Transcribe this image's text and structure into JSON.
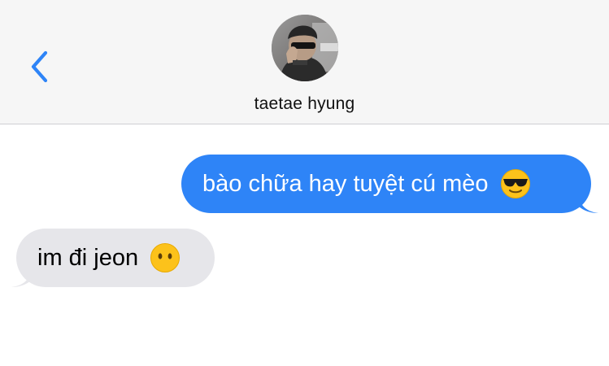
{
  "header": {
    "back_icon": "chevron-left-icon",
    "contact_name": "taetae hyung"
  },
  "messages": [
    {
      "direction": "outgoing",
      "text": "bào chữa hay tuyệt cú mèo",
      "emoji": "smiling-face-with-sunglasses"
    },
    {
      "direction": "incoming",
      "text": "im đi jeon",
      "emoji": "face-without-mouth"
    }
  ],
  "colors": {
    "accent": "#2e84f7",
    "outgoing_bubble": "#2e84f7",
    "incoming_bubble": "#e6e6ea",
    "header_bg": "#f6f6f6"
  }
}
